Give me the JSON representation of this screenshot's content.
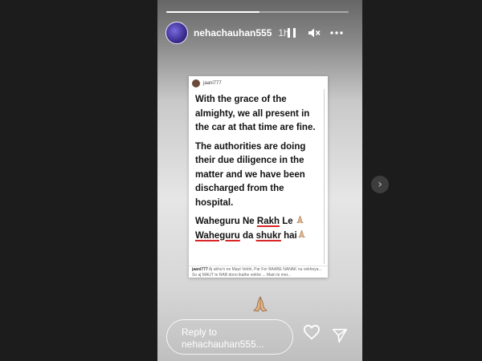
{
  "story": {
    "username": "nehachauhan555",
    "time": "1h",
    "progress": 0.51,
    "icons": {
      "pause": "pause-icon",
      "mute": "speaker-muted-icon",
      "more": "more-options-icon",
      "like": "heart-icon",
      "send": "send-icon",
      "next": "chevron-right-icon"
    },
    "post": {
      "username": "jaani777",
      "lines": [
        "With the grace of the almighty, we all present in the car at that time are fine.",
        "The authorities are doing their due diligence in the matter and we have been discharged from the hospital."
      ],
      "line3_a": "Waheguru Ne ",
      "line3_b": "Rakh",
      "line3_c": " Le ",
      "line4_a": "Waheguru",
      "line4_b": " da ",
      "line4_c": "shukr",
      "line4_d": " hai",
      "caption_user": "jaani777",
      "caption_text": " Aj akhu'n ne Maut Vekhi, Par Fer BAABE NANAK nu vekheya... So aj MAUT te RAB dono ikathe vekhe ... Main te mer..."
    },
    "reply_placeholder_line1": "Reply to",
    "reply_placeholder_line2": "nehachauhan555..."
  },
  "colors": {
    "underline": "#d92525",
    "background": "#1f1f1f"
  }
}
